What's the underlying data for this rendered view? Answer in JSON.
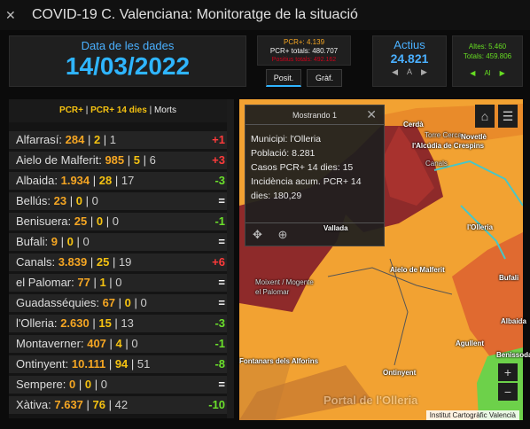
{
  "title": "COVID-19 C. Valenciana: Monitoratge de la situació",
  "date_label": "Data de les dades",
  "date_value": "14/03/2022",
  "pcr": {
    "pcr": "PCR+: 4.139",
    "totals": "PCR+ totals: 480.707",
    "deaths": "Positius totals: 492.162"
  },
  "tabs": {
    "posit": "Posit.",
    "graf": "Gràf."
  },
  "active": {
    "label": "Actius",
    "value": "24.821",
    "prev": "◀",
    "page": "A",
    "next": "▶"
  },
  "discharges": {
    "line1": "Altes: 5.460",
    "line2": "Totals: 459.806",
    "prev": "◀",
    "page": "Al",
    "next": "▶"
  },
  "list_header": {
    "a": "PCR+",
    "b": "PCR+ 14 dies",
    "c": "Morts",
    "sep": " | "
  },
  "rows": [
    {
      "name": "Alfarrasí:",
      "pcr": "284",
      "c14": "2",
      "d": "1",
      "delta": "+1",
      "dir": "up"
    },
    {
      "name": "Aielo de Malferit:",
      "pcr": "985",
      "c14": "5",
      "d": "6",
      "delta": "+3",
      "dir": "up"
    },
    {
      "name": "Albaida:",
      "pcr": "1.934",
      "c14": "28",
      "d": "17",
      "delta": "-3",
      "dir": "dn"
    },
    {
      "name": "Bellús:",
      "pcr": "23",
      "c14": "0",
      "d": "0",
      "delta": "=",
      "dir": "eq"
    },
    {
      "name": "Benisuera:",
      "pcr": "25",
      "c14": "0",
      "d": "0",
      "delta": "-1",
      "dir": "dn"
    },
    {
      "name": "Bufali:",
      "pcr": "9",
      "c14": "0",
      "d": "0",
      "delta": "=",
      "dir": "eq"
    },
    {
      "name": "Canals:",
      "pcr": "3.839",
      "c14": "25",
      "d": "19",
      "delta": "+6",
      "dir": "up"
    },
    {
      "name": "el Palomar:",
      "pcr": "77",
      "c14": "1",
      "d": "0",
      "delta": "=",
      "dir": "eq"
    },
    {
      "name": "Guadasséquies:",
      "pcr": "67",
      "c14": "0",
      "d": "0",
      "delta": "=",
      "dir": "eq"
    },
    {
      "name": "l'Olleria:",
      "pcr": "2.630",
      "c14": "15",
      "d": "13",
      "delta": "-3",
      "dir": "dn"
    },
    {
      "name": "Montaverner:",
      "pcr": "407",
      "c14": "4",
      "d": "0",
      "delta": "-1",
      "dir": "dn"
    },
    {
      "name": "Ontinyent:",
      "pcr": "10.111",
      "c14": "94",
      "d": "51",
      "delta": "-8",
      "dir": "dn"
    },
    {
      "name": "Sempere:",
      "pcr": "0",
      "c14": "0",
      "d": "0",
      "delta": "=",
      "dir": "eq"
    },
    {
      "name": "Xàtiva:",
      "pcr": "7.637",
      "c14": "76",
      "d": "42",
      "delta": "-10",
      "dir": "dn"
    }
  ],
  "popup": {
    "title": "Mostrando 1",
    "municipi": "Municipi: l'Olleria",
    "poblacio": "Població: 8.281",
    "casos": "Casos PCR+ 14 dies: 15",
    "incidencia": "Incidència acum. PCR+ 14 dies: 180,29"
  },
  "map_places": [
    "Cerdà",
    "Torre Cerca",
    "l'Alcúdia de Crespins",
    "Novetlè",
    "Canals",
    "l'Olleria",
    "Vallada",
    "Aielo de Malferit",
    "Moixent / Mogente",
    "el Palomar",
    "Bufali",
    "Albaida",
    "Agullent",
    "Benissoda",
    "Ontinyent",
    "Fontanars dels Alforins",
    "Portal de l'Olleria"
  ],
  "attribution": "Institut Cartogràfic Valencià",
  "colors": {
    "accent": "#2fb5ff",
    "up": "#ff3b3b",
    "down": "#6be02b",
    "pcr": "#f5a623"
  }
}
